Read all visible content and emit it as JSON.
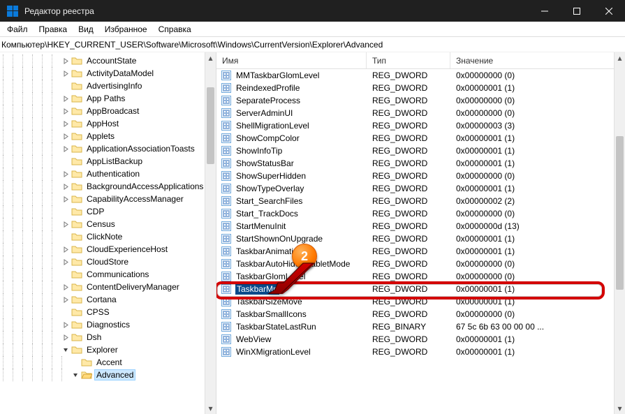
{
  "window": {
    "title": "Редактор реестра"
  },
  "menu": {
    "file": "Файл",
    "edit": "Правка",
    "view": "Вид",
    "favorites": "Избранное",
    "help": "Справка"
  },
  "address": "Компьютер\\HKEY_CURRENT_USER\\Software\\Microsoft\\Windows\\CurrentVersion\\Explorer\\Advanced",
  "tree": {
    "items": [
      {
        "indent": 8,
        "exp": "closed",
        "name": "AccountState"
      },
      {
        "indent": 8,
        "exp": "closed",
        "name": "ActivityDataModel"
      },
      {
        "indent": 8,
        "exp": "none",
        "name": "AdvertisingInfo"
      },
      {
        "indent": 8,
        "exp": "closed",
        "name": "App Paths"
      },
      {
        "indent": 8,
        "exp": "closed",
        "name": "AppBroadcast"
      },
      {
        "indent": 8,
        "exp": "closed",
        "name": "AppHost"
      },
      {
        "indent": 8,
        "exp": "closed",
        "name": "Applets"
      },
      {
        "indent": 8,
        "exp": "closed",
        "name": "ApplicationAssociationToasts"
      },
      {
        "indent": 8,
        "exp": "none",
        "name": "AppListBackup"
      },
      {
        "indent": 8,
        "exp": "closed",
        "name": "Authentication"
      },
      {
        "indent": 8,
        "exp": "closed",
        "name": "BackgroundAccessApplications"
      },
      {
        "indent": 8,
        "exp": "closed",
        "name": "CapabilityAccessManager"
      },
      {
        "indent": 8,
        "exp": "none",
        "name": "CDP"
      },
      {
        "indent": 8,
        "exp": "closed",
        "name": "Census"
      },
      {
        "indent": 8,
        "exp": "none",
        "name": "ClickNote"
      },
      {
        "indent": 8,
        "exp": "closed",
        "name": "CloudExperienceHost"
      },
      {
        "indent": 8,
        "exp": "closed",
        "name": "CloudStore"
      },
      {
        "indent": 8,
        "exp": "none",
        "name": "Communications"
      },
      {
        "indent": 8,
        "exp": "closed",
        "name": "ContentDeliveryManager"
      },
      {
        "indent": 8,
        "exp": "closed",
        "name": "Cortana"
      },
      {
        "indent": 8,
        "exp": "none",
        "name": "CPSS"
      },
      {
        "indent": 8,
        "exp": "closed",
        "name": "Diagnostics"
      },
      {
        "indent": 8,
        "exp": "closed",
        "name": "Dsh"
      },
      {
        "indent": 8,
        "exp": "open",
        "name": "Explorer"
      },
      {
        "indent": 9,
        "exp": "none",
        "name": "Accent"
      },
      {
        "indent": 9,
        "exp": "open",
        "name": "Advanced",
        "selected": true,
        "openFolder": true
      }
    ]
  },
  "columns": {
    "name": "Имя",
    "type": "Тип",
    "value": "Значение"
  },
  "rows": [
    {
      "name": "MMTaskbarGlomLevel",
      "type": "REG_DWORD",
      "value": "0x00000000 (0)"
    },
    {
      "name": "ReindexedProfile",
      "type": "REG_DWORD",
      "value": "0x00000001 (1)"
    },
    {
      "name": "SeparateProcess",
      "type": "REG_DWORD",
      "value": "0x00000000 (0)"
    },
    {
      "name": "ServerAdminUI",
      "type": "REG_DWORD",
      "value": "0x00000000 (0)"
    },
    {
      "name": "ShellMigrationLevel",
      "type": "REG_DWORD",
      "value": "0x00000003 (3)"
    },
    {
      "name": "ShowCompColor",
      "type": "REG_DWORD",
      "value": "0x00000001 (1)"
    },
    {
      "name": "ShowInfoTip",
      "type": "REG_DWORD",
      "value": "0x00000001 (1)"
    },
    {
      "name": "ShowStatusBar",
      "type": "REG_DWORD",
      "value": "0x00000001 (1)"
    },
    {
      "name": "ShowSuperHidden",
      "type": "REG_DWORD",
      "value": "0x00000000 (0)"
    },
    {
      "name": "ShowTypeOverlay",
      "type": "REG_DWORD",
      "value": "0x00000001 (1)"
    },
    {
      "name": "Start_SearchFiles",
      "type": "REG_DWORD",
      "value": "0x00000002 (2)"
    },
    {
      "name": "Start_TrackDocs",
      "type": "REG_DWORD",
      "value": "0x00000000 (0)"
    },
    {
      "name": "StartMenuInit",
      "type": "REG_DWORD",
      "value": "0x0000000d (13)"
    },
    {
      "name": "StartShownOnUpgrade",
      "type": "REG_DWORD",
      "value": "0x00000001 (1)"
    },
    {
      "name": "TaskbarAnimations",
      "type": "REG_DWORD",
      "value": "0x00000001 (1)"
    },
    {
      "name": "TaskbarAutoHideInTabletMode",
      "type": "REG_DWORD",
      "value": "0x00000000 (0)"
    },
    {
      "name": "TaskbarGlomLevel",
      "type": "REG_DWORD",
      "value": "0x00000000 (0)"
    },
    {
      "name": "TaskbarMn",
      "type": "REG_DWORD",
      "value": "0x00000001 (1)",
      "editing": true
    },
    {
      "name": "TaskbarSizeMove",
      "type": "REG_DWORD",
      "value": "0x00000001 (1)"
    },
    {
      "name": "TaskbarSmallIcons",
      "type": "REG_DWORD",
      "value": "0x00000000 (0)"
    },
    {
      "name": "TaskbarStateLastRun",
      "type": "REG_BINARY",
      "value": "67 5c 6b 63 00 00 00 ..."
    },
    {
      "name": "WebView",
      "type": "REG_DWORD",
      "value": "0x00000001 (1)"
    },
    {
      "name": "WinXMigrationLevel",
      "type": "REG_DWORD",
      "value": "0x00000001 (1)"
    }
  ],
  "annotation": {
    "badge": "2"
  }
}
